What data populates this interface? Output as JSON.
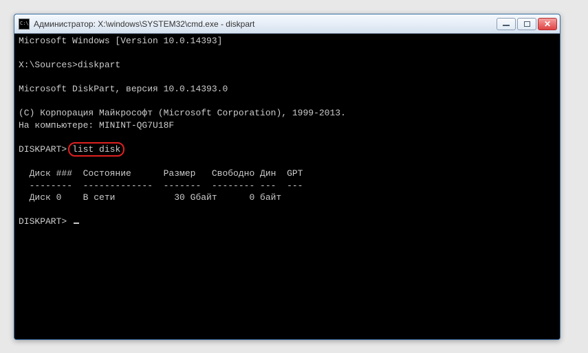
{
  "window": {
    "title": "Администратор: X:\\windows\\SYSTEM32\\cmd.exe - diskpart"
  },
  "terminal": {
    "version_line": "Microsoft Windows [Version 10.0.14393]",
    "prompt1_path": "X:\\Sources>",
    "prompt1_cmd": "diskpart",
    "diskpart_version": "Microsoft DiskPart, версия 10.0.14393.0",
    "copyright": "(C) Корпорация Майкрософт (Microsoft Corporation), 1999-2013.",
    "computer": "На компьютере: MININT-QG7U18F",
    "dp_prompt": "DISKPART>",
    "dp_cmd": "list disk",
    "table": {
      "header": "  Диск ###  Состояние      Размер   Свободно Дин  GPT",
      "sep": "  --------  -------------  -------  -------- ---  ---",
      "row0": "  Диск 0    В сети           30 Gбайт      0 байт"
    }
  }
}
